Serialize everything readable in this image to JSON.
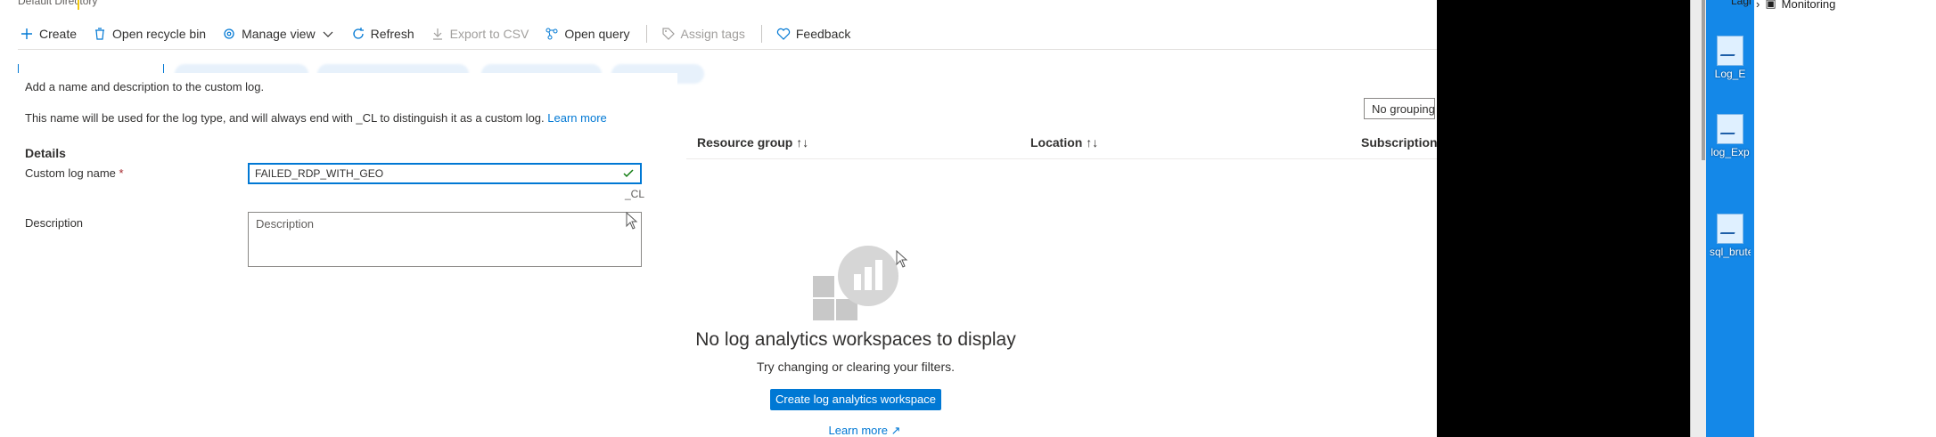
{
  "portal": {
    "directory_label": "Default Directory",
    "toolbar": {
      "create": "Create",
      "recycle_bin": "Open recycle bin",
      "manage_view": "Manage view",
      "refresh": "Refresh",
      "export_csv": "Export to CSV",
      "open_query": "Open query",
      "assign_tags": "Assign tags",
      "feedback": "Feedback"
    },
    "grouping": "No grouping",
    "columns": [
      "Resource group",
      "Location",
      "Subscription"
    ],
    "empty_state": {
      "title": "No log analytics workspaces to display",
      "subtitle": "Try changing or clearing your filters.",
      "create_button": "Create log analytics workspace",
      "learn_more": "Learn more"
    }
  },
  "panel": {
    "intro": "Add a name and description to the custom log.",
    "info": "This name will be used for the log type, and will always end with _CL to distinguish it as a custom log.",
    "info_link": "Learn more",
    "details_heading": "Details",
    "name_label": "Custom log name",
    "required_mark": "*",
    "name_value": "FAILED_RDP_WITH_GEO",
    "suffix": "_CL",
    "description_label": "Description",
    "description_placeholder": "Description"
  },
  "desktop": {
    "icons": [
      "Log_E",
      "log_Exp",
      "sql_brute"
    ],
    "explorer_item": "Monitoring",
    "explorer_cut_label": "Lagi"
  },
  "colors": {
    "accent": "#0078d4",
    "desktop_blue": "#1488e8",
    "required": "#a4262c"
  }
}
